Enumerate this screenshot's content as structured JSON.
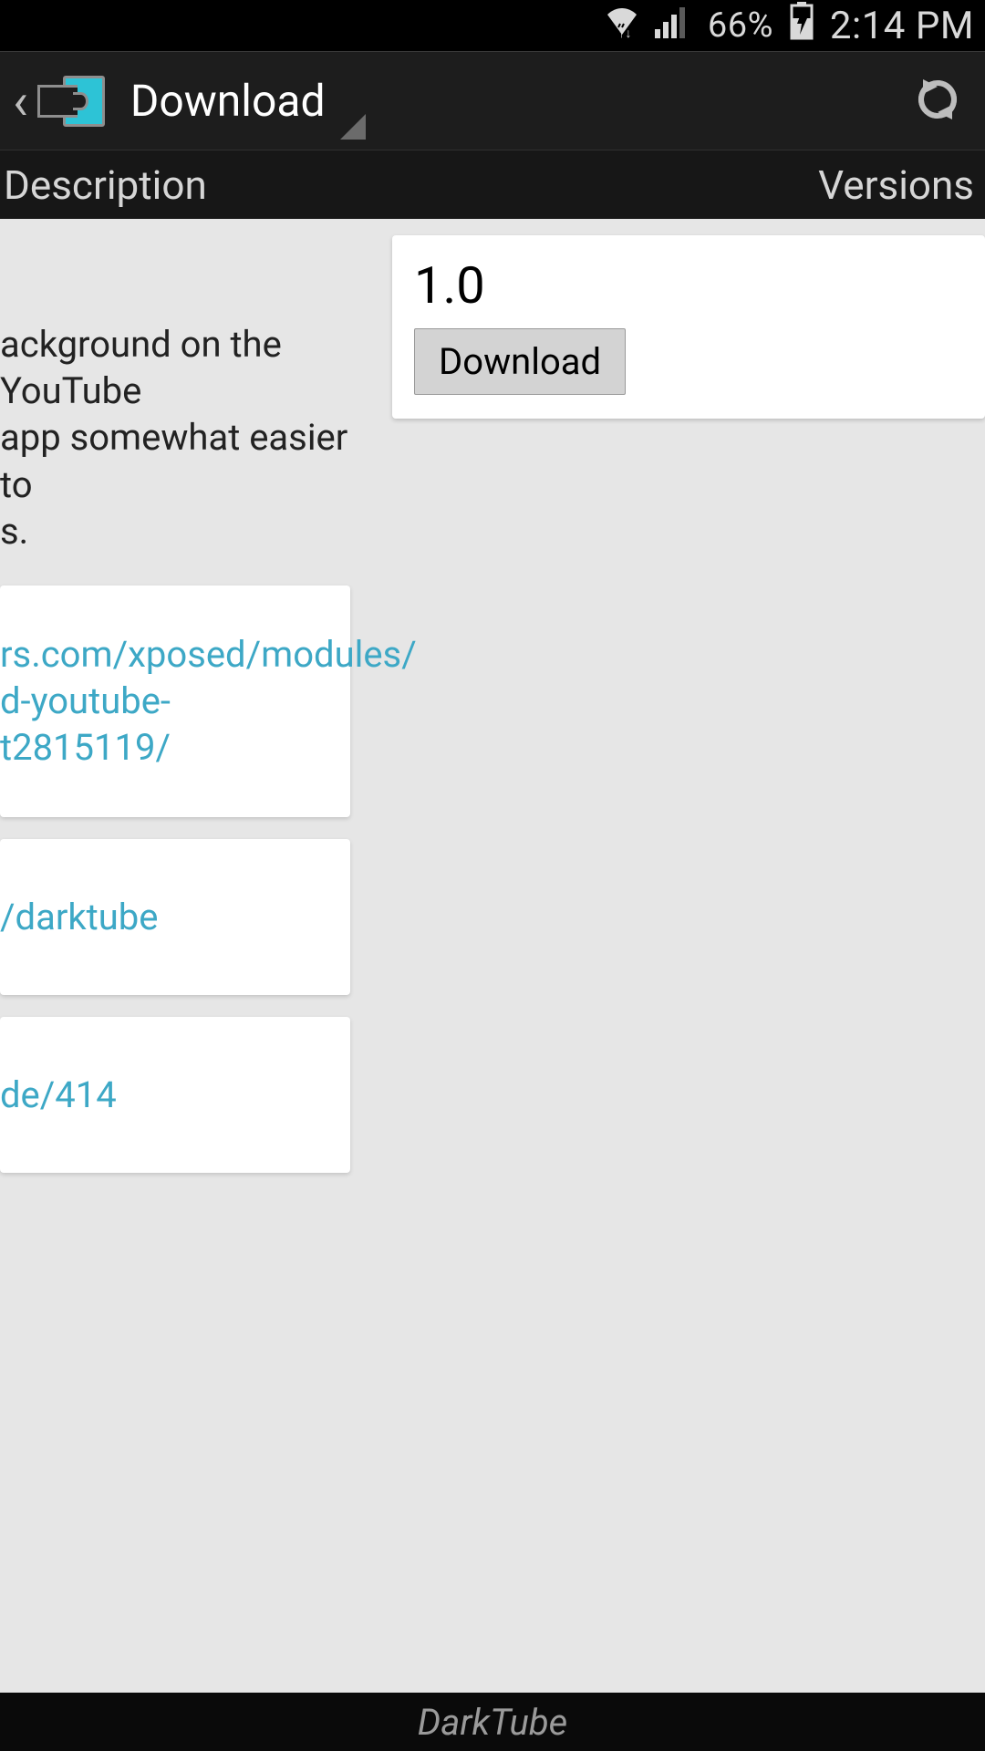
{
  "status": {
    "battery": "66%",
    "time": "2:14 PM"
  },
  "appbar": {
    "title": "Download"
  },
  "tabs": {
    "left": "Description",
    "right": "Versions"
  },
  "description": {
    "line1": "ackground on the YouTube",
    "line2": " app somewhat easier to",
    "line3": "s."
  },
  "links": {
    "l1a": "rs.com/xposed/modules/",
    "l1b": "d-youtube-t2815119/",
    "l2": "/darktube",
    "l3": "de/414"
  },
  "version": {
    "number": "1.0",
    "button": "Download"
  },
  "footer": {
    "label": "DarkTube"
  }
}
